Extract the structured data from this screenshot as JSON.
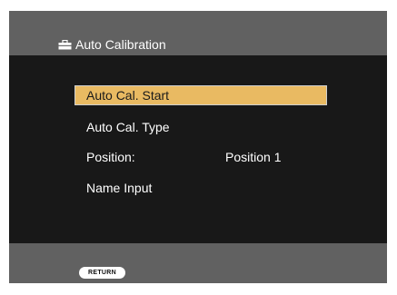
{
  "header": {
    "title": "Auto Calibration",
    "icon": "toolbox-icon"
  },
  "menu": {
    "items": [
      {
        "label": "Auto Cal. Start",
        "value": "",
        "selected": true
      },
      {
        "label": "Auto Cal. Type",
        "value": "",
        "selected": false
      },
      {
        "label": "Position:",
        "value": "Position 1",
        "selected": false
      },
      {
        "label": "Name Input",
        "value": "",
        "selected": false
      }
    ]
  },
  "footer": {
    "return_label": "RETURN"
  },
  "colors": {
    "background": "#181818",
    "bar": "#616161",
    "highlight": "#e9ba62",
    "highlight_border": "#cfd0d0",
    "text": "#ffffff"
  }
}
